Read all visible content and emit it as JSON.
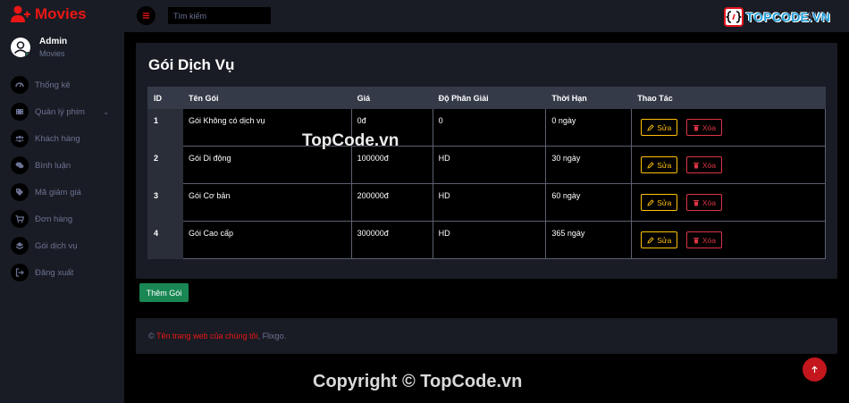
{
  "brand": {
    "name": "Movies",
    "color": "#eb1616"
  },
  "profile": {
    "name": "Admin",
    "role": "Movies"
  },
  "sidebar": {
    "items": [
      {
        "label": "Thống kê",
        "icon": "dashboard-icon"
      },
      {
        "label": "Quản lý phim",
        "icon": "film-icon",
        "has_children": true
      },
      {
        "label": "Khách hàng",
        "icon": "users-icon"
      },
      {
        "label": "Bình luận",
        "icon": "comments-icon"
      },
      {
        "label": "Mã giảm giá",
        "icon": "tags-icon"
      },
      {
        "label": "Đơn hàng",
        "icon": "cart-icon"
      },
      {
        "label": "Gói dịch vụ",
        "icon": "package-icon"
      },
      {
        "label": "Đăng xuất",
        "icon": "logout-icon"
      }
    ]
  },
  "topbar": {
    "search_placeholder": "Tìm kiếm",
    "user_label": "Admin"
  },
  "main": {
    "title": "Gói Dịch Vụ",
    "columns": [
      "ID",
      "Tên Gói",
      "Giá",
      "Độ Phân Giải",
      "Thời Hạn",
      "Thao Tác"
    ],
    "rows": [
      {
        "id": "1",
        "name": "Gói Không có dịch vụ",
        "price": "0đ",
        "resolution": "0",
        "duration": "0 ngày"
      },
      {
        "id": "2",
        "name": "Gói Di động",
        "price": "100000đ",
        "resolution": "HD",
        "duration": "30 ngày"
      },
      {
        "id": "3",
        "name": "Gói Cơ bản",
        "price": "200000đ",
        "resolution": "HD",
        "duration": "60 ngày"
      },
      {
        "id": "4",
        "name": "Gói Cao cấp",
        "price": "300000đ",
        "resolution": "HD",
        "duration": "365 ngày"
      }
    ],
    "edit_label": "Sửa",
    "delete_label": "Xóa",
    "add_label": "Thêm Gói"
  },
  "footer": {
    "prefix": "© ",
    "link": "Tên trang web của chúng tôi",
    "suffix": ", Flixgo."
  },
  "watermark": {
    "logo_text": "TOPCODE.VN",
    "center_text": "TopCode.vn",
    "bottom_text": "Copyright © TopCode.vn"
  },
  "colors": {
    "bg": "#000000",
    "panel": "#191c24",
    "accent": "#eb1616",
    "warning": "#ffc107",
    "danger": "#dc3545",
    "success": "#198754"
  }
}
